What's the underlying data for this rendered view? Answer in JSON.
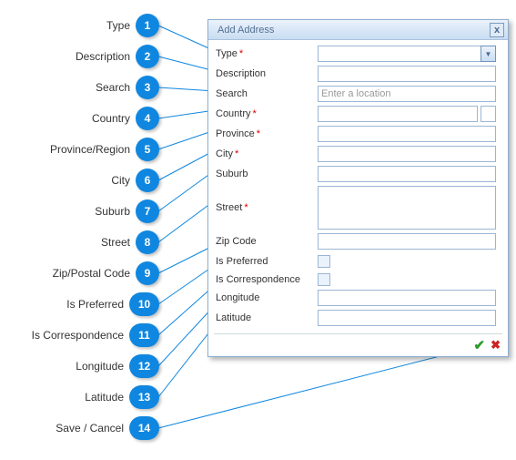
{
  "dialog": {
    "title": "Add Address",
    "close_label": "x",
    "fields": {
      "type": {
        "label": "Type"
      },
      "description": {
        "label": "Description"
      },
      "search": {
        "label": "Search",
        "placeholder": "Enter a location"
      },
      "country": {
        "label": "Country"
      },
      "province": {
        "label": "Province"
      },
      "city": {
        "label": "City"
      },
      "suburb": {
        "label": "Suburb"
      },
      "street": {
        "label": "Street"
      },
      "zip": {
        "label": "Zip Code"
      },
      "is_preferred": {
        "label": "Is Preferred"
      },
      "is_correspondence": {
        "label": "Is Correspondence"
      },
      "longitude": {
        "label": "Longitude"
      },
      "latitude": {
        "label": "Latitude"
      }
    },
    "required_marker": "*",
    "dropdown_glyph": "▼",
    "ok_glyph": "✔",
    "cancel_glyph": "✖"
  },
  "legend": {
    "items": [
      {
        "n": "1",
        "label": "Type"
      },
      {
        "n": "2",
        "label": "Description"
      },
      {
        "n": "3",
        "label": "Search"
      },
      {
        "n": "4",
        "label": "Country"
      },
      {
        "n": "5",
        "label": "Province/Region"
      },
      {
        "n": "6",
        "label": "City"
      },
      {
        "n": "7",
        "label": "Suburb"
      },
      {
        "n": "8",
        "label": "Street"
      },
      {
        "n": "9",
        "label": "Zip/Postal Code"
      },
      {
        "n": "10",
        "label": "Is Preferred"
      },
      {
        "n": "11",
        "label": "Is Correspondence"
      },
      {
        "n": "12",
        "label": "Longitude"
      },
      {
        "n": "13",
        "label": "Latitude"
      },
      {
        "n": "14",
        "label": "Save / Cancel"
      }
    ]
  }
}
